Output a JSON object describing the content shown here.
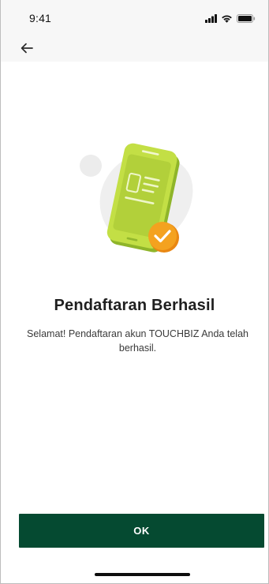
{
  "status_bar": {
    "time": "9:41",
    "icons": [
      "signal-icon",
      "wifi-icon",
      "battery-icon"
    ]
  },
  "header": {
    "back_icon": "back-arrow-icon"
  },
  "illustration": {
    "icon": "phone-document-check-icon"
  },
  "content": {
    "title": "Pendaftaran Berhasil",
    "message": "Selamat! Pendaftaran akun TOUCHBIZ Anda telah berhasil."
  },
  "actions": {
    "ok_label": "OK"
  },
  "colors": {
    "primary_button": "#054a31",
    "phone_green": "#b6d63b",
    "check_orange": "#f39a1c",
    "header_background": "#f7f7f7"
  }
}
